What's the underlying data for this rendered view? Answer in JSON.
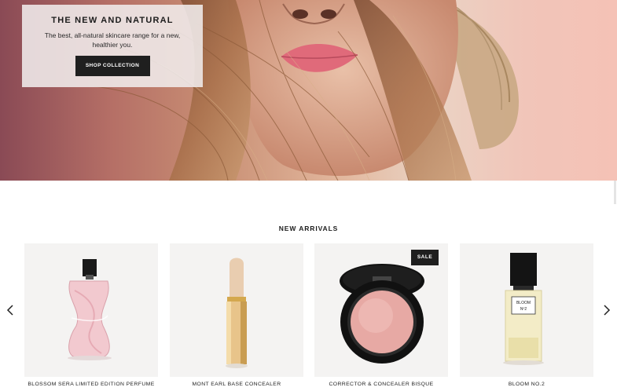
{
  "hero": {
    "image": "woman-face-with-straw-hat",
    "promo": {
      "title": "THE NEW AND NATURAL",
      "subtitle": "The best, all-natural skincare range for a new, healthier you.",
      "button_label": "SHOP COLLECTION"
    }
  },
  "new_arrivals": {
    "title": "NEW ARRIVALS",
    "prev_icon": "chevron-left-icon",
    "next_icon": "chevron-right-icon",
    "products": [
      {
        "name": "BLOSSOM SERA LIMITED EDITION PERFUME",
        "image": "pink-perfume-bottle"
      },
      {
        "name": "MONT EARL BASE CONCEALER",
        "image": "gold-concealer-stick"
      },
      {
        "name": "CORRECTOR & CONCEALER BISQUE",
        "image": "black-compact-blush",
        "badge": "SALE"
      },
      {
        "name": "BLOOM NO.2",
        "image": "perfume-bottle-black-cap",
        "label_text": [
          "BLOOM",
          "Nº2"
        ]
      }
    ]
  },
  "colors": {
    "button_bg": "#1f1f1f",
    "badge_bg": "#1f1f1f",
    "card_bg": "#f4f3f2",
    "hero_bg": "#f5c2b6"
  }
}
